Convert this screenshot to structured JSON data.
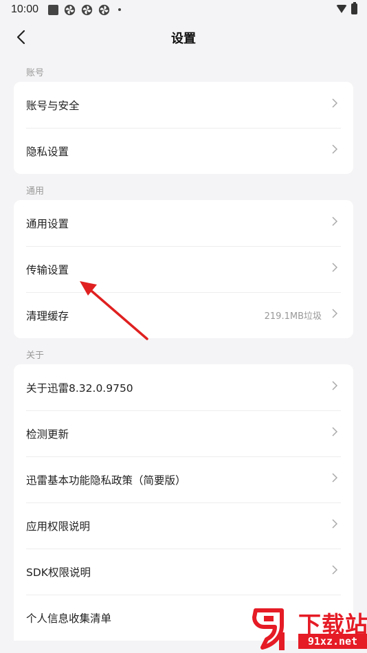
{
  "status_bar": {
    "time": "10:00"
  },
  "nav": {
    "title": "设置"
  },
  "sections": [
    {
      "label": "账号",
      "items": [
        {
          "label": "账号与安全"
        },
        {
          "label": "隐私设置"
        }
      ]
    },
    {
      "label": "通用",
      "items": [
        {
          "label": "通用设置"
        },
        {
          "label": "传输设置"
        },
        {
          "label": "清理缓存",
          "value": "219.1MB垃圾"
        }
      ]
    },
    {
      "label": "关于",
      "items": [
        {
          "label": "关于迅雷8.32.0.9750"
        },
        {
          "label": "检测更新"
        },
        {
          "label": "迅雷基本功能隐私政策（简要版）"
        },
        {
          "label": "应用权限说明"
        },
        {
          "label": "SDK权限说明"
        },
        {
          "label": "个人信息收集清单"
        }
      ]
    }
  ],
  "watermark": {
    "title": "下载站",
    "url": "91xz.net"
  },
  "colors": {
    "annotation_arrow": "#e02020",
    "watermark": "#e51b25"
  }
}
